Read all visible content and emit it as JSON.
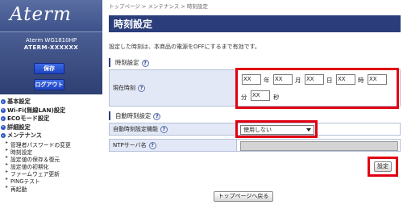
{
  "sidebar": {
    "logo": "Aterm",
    "model_line1": "Aterm WG1810HP",
    "model_line2": "ATERM-XXXXXX",
    "save_label": "保存",
    "logout_label": "ログアウト",
    "menu": [
      {
        "label": "基本設定"
      },
      {
        "label": "Wi-Fi(無線LAN)設定"
      },
      {
        "label": "ECOモード設定"
      },
      {
        "label": "詳細設定"
      },
      {
        "label": "メンテナンス"
      }
    ],
    "maintenance_items": [
      {
        "label": "管理者パスワードの変更"
      },
      {
        "label": "時刻設定"
      },
      {
        "label": "設定値の保存＆復元"
      },
      {
        "label": "設定値の初期化"
      },
      {
        "label": "ファームウェア更新"
      },
      {
        "label": "PINGテスト"
      },
      {
        "label": "再起動"
      }
    ]
  },
  "breadcrumb": "トップページ > メンテナンス > 時刻設定",
  "page_title": "時刻設定",
  "description": "設定した時刻は、本商品の電源をOFFにするまで有効です。",
  "section_time": {
    "title": "時刻設定",
    "help": "?",
    "current_time_label": "現在時刻",
    "fields": {
      "year": "XX",
      "month": "XX",
      "day": "XX",
      "hour": "XX",
      "minute": "XX",
      "second": "XX"
    },
    "units": {
      "year": "年",
      "month": "月",
      "day": "日",
      "hour": "時",
      "minute": "分",
      "second": "秒"
    }
  },
  "section_auto": {
    "title": "自動時刻設定",
    "help": "?",
    "auto_label": "自動時刻設定機能",
    "auto_value": "使用しない",
    "ntp_label": "NTPサーバ名",
    "ntp_value": ""
  },
  "buttons": {
    "set": "設定",
    "back_to_top": "トップページへ戻る"
  },
  "colors": {
    "header_bg": "#2b3e7b",
    "label_bg": "#e2e8f5",
    "highlight": "#e00012"
  }
}
